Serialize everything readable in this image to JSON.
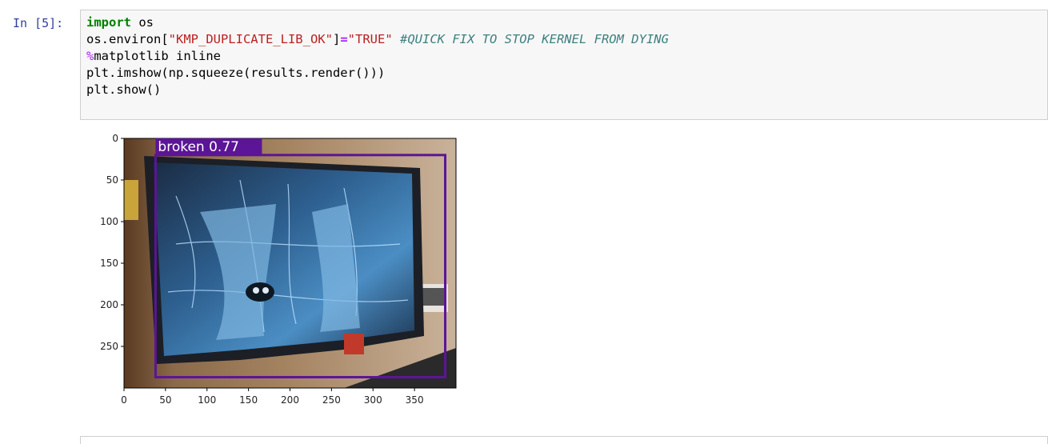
{
  "cell": {
    "prompt": "In [5]:",
    "code_lines": [
      {
        "parts": [
          {
            "t": "import",
            "c": "kw"
          },
          {
            "t": " os",
            "c": ""
          }
        ]
      },
      {
        "parts": [
          {
            "t": "os.environ[",
            "c": ""
          },
          {
            "t": "\"KMP_DUPLICATE_LIB_OK\"",
            "c": "str"
          },
          {
            "t": "]",
            "c": ""
          },
          {
            "t": "=",
            "c": "op"
          },
          {
            "t": "\"TRUE\"",
            "c": "str"
          },
          {
            "t": " ",
            "c": ""
          },
          {
            "t": "#QUICK FIX TO STOP KERNEL FROM DYING",
            "c": "cm"
          }
        ]
      },
      {
        "parts": [
          {
            "t": "%",
            "c": "magic"
          },
          {
            "t": "matplotlib inline",
            "c": ""
          }
        ]
      },
      {
        "parts": [
          {
            "t": "plt.imshow(np.squeeze(results.render()))",
            "c": ""
          }
        ]
      },
      {
        "parts": [
          {
            "t": "plt.show()",
            "c": ""
          }
        ]
      }
    ]
  },
  "plot": {
    "detection_label": "broken 0.77",
    "box_color": "#5b1596",
    "chart_data": {
      "type": "image",
      "xlim": [
        0,
        400
      ],
      "ylim": [
        300,
        0
      ],
      "x_ticks": [
        "0",
        "50",
        "100",
        "150",
        "200",
        "250",
        "300",
        "350"
      ],
      "y_ticks": [
        "0",
        "50",
        "100",
        "150",
        "200",
        "250"
      ],
      "bounding_box": {
        "x1": 38,
        "y1": 20,
        "x2": 387,
        "y2": 287
      }
    }
  }
}
